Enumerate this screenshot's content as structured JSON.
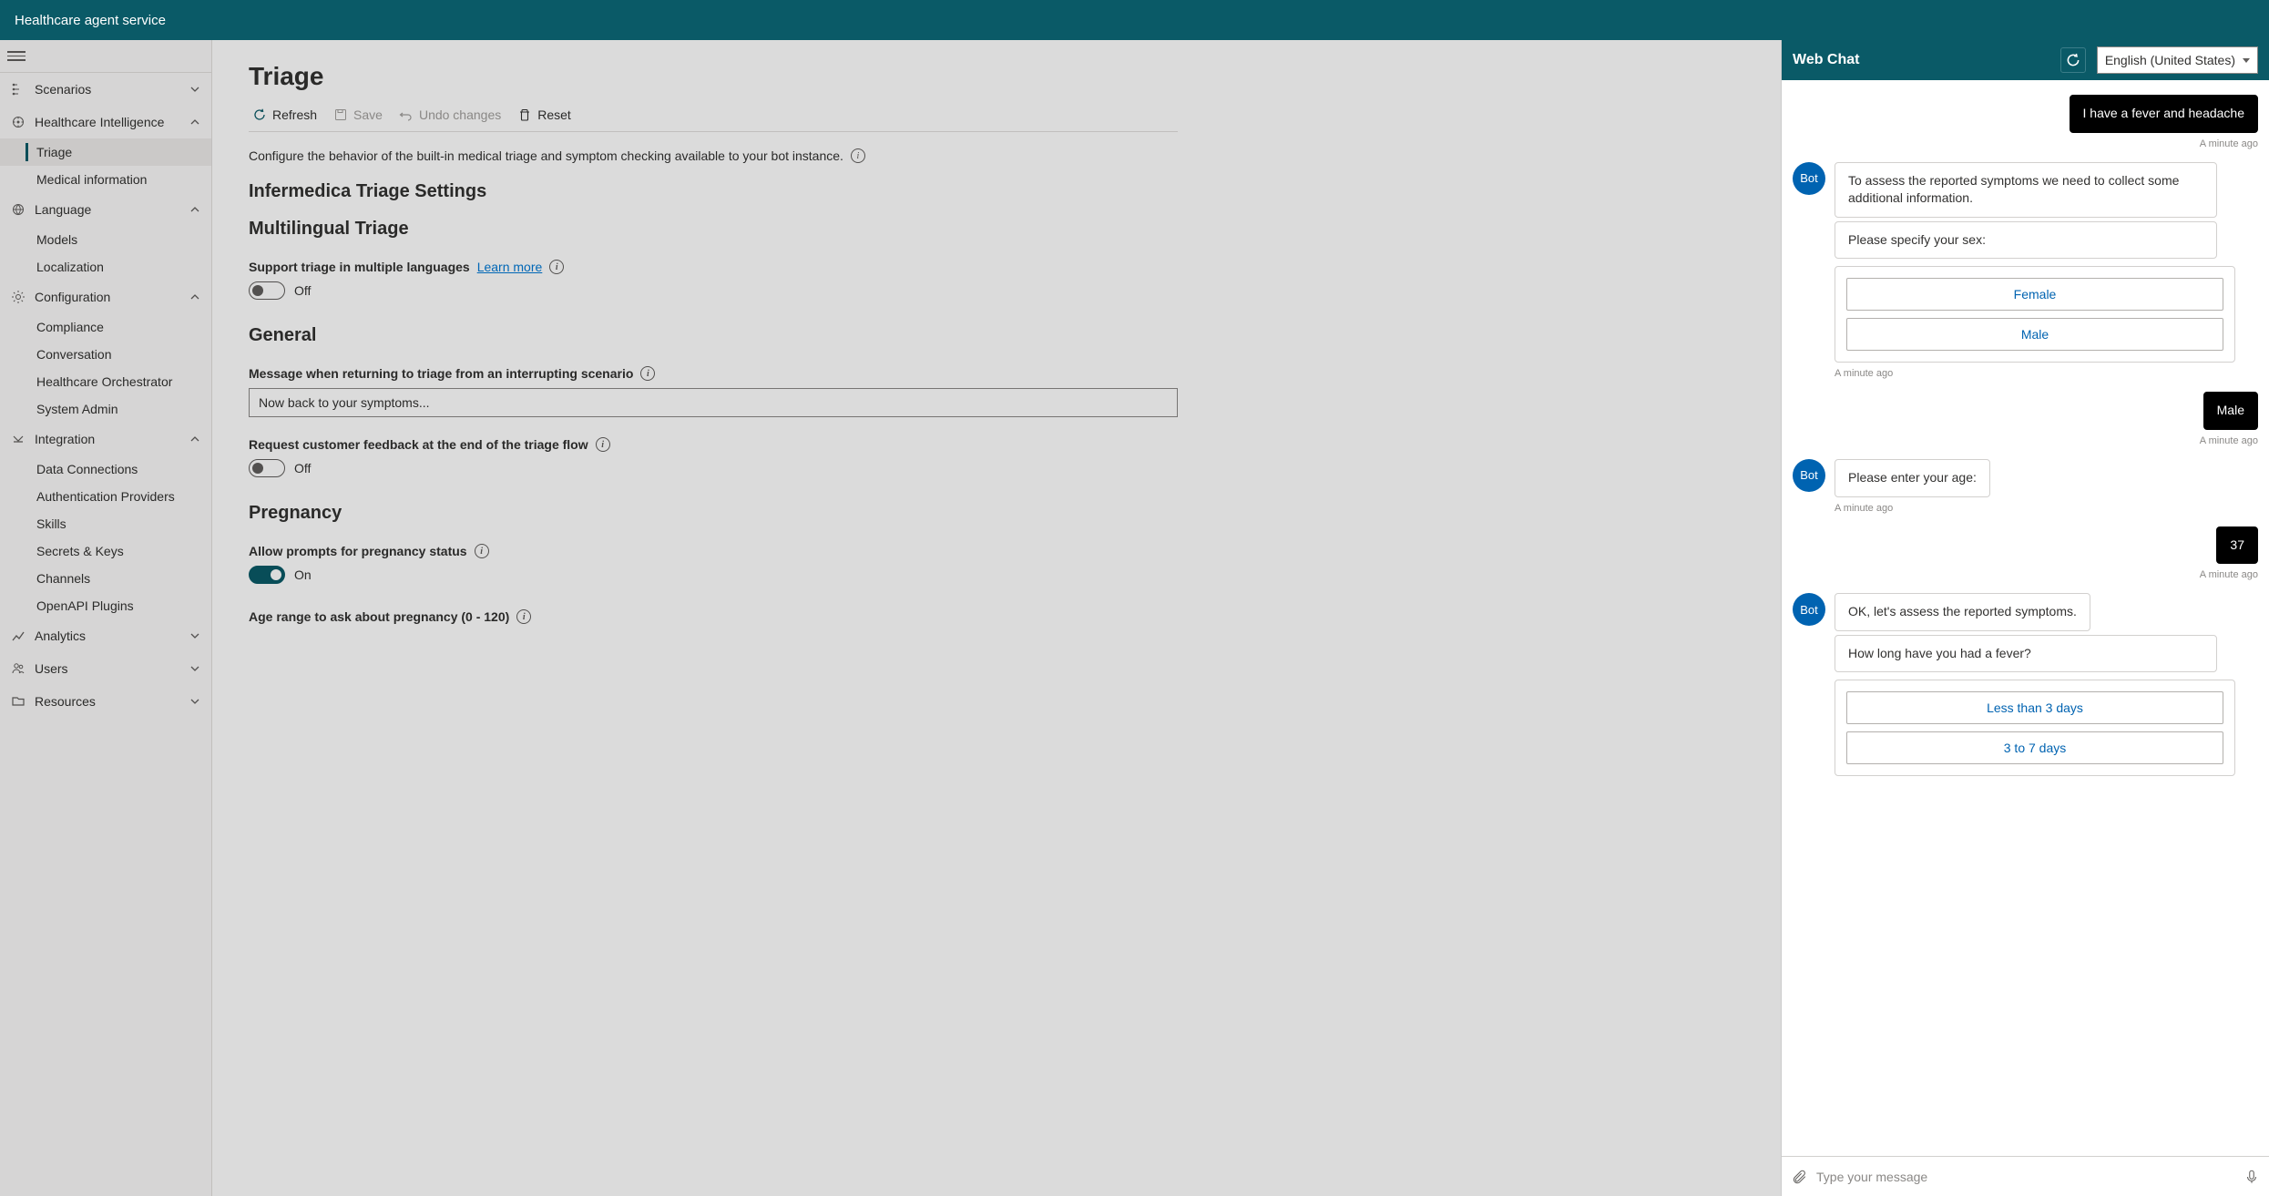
{
  "header": {
    "title": "Healthcare agent service"
  },
  "sidebar": {
    "groups": [
      {
        "label": "Scenarios",
        "expanded": false,
        "items": []
      },
      {
        "label": "Healthcare Intelligence",
        "expanded": true,
        "items": [
          {
            "label": "Triage",
            "active": true
          },
          {
            "label": "Medical information"
          }
        ]
      },
      {
        "label": "Language",
        "expanded": true,
        "items": [
          {
            "label": "Models"
          },
          {
            "label": "Localization"
          }
        ]
      },
      {
        "label": "Configuration",
        "expanded": true,
        "items": [
          {
            "label": "Compliance"
          },
          {
            "label": "Conversation"
          },
          {
            "label": "Healthcare Orchestrator"
          },
          {
            "label": "System Admin"
          }
        ]
      },
      {
        "label": "Integration",
        "expanded": true,
        "items": [
          {
            "label": "Data Connections"
          },
          {
            "label": "Authentication Providers"
          },
          {
            "label": "Skills"
          },
          {
            "label": "Secrets & Keys"
          },
          {
            "label": "Channels"
          },
          {
            "label": "OpenAPI Plugins"
          }
        ]
      },
      {
        "label": "Analytics",
        "expanded": false,
        "items": []
      },
      {
        "label": "Users",
        "expanded": false,
        "items": []
      },
      {
        "label": "Resources",
        "expanded": false,
        "items": []
      }
    ]
  },
  "main": {
    "title": "Triage",
    "toolbar": {
      "refresh": "Refresh",
      "save": "Save",
      "undo": "Undo changes",
      "reset": "Reset"
    },
    "description": "Configure the behavior of the built-in medical triage and symptom checking available to your bot instance.",
    "sections": {
      "infermedica": "Infermedica Triage Settings",
      "multilingual": {
        "heading": "Multilingual Triage",
        "label": "Support triage in multiple languages",
        "learn_more": "Learn more",
        "toggle_value": "Off"
      },
      "general": {
        "heading": "General",
        "return_msg_label": "Message when returning to triage from an interrupting scenario",
        "return_msg_value": "Now back to your symptoms...",
        "feedback_label": "Request customer feedback at the end of the triage flow",
        "feedback_value": "Off"
      },
      "pregnancy": {
        "heading": "Pregnancy",
        "allow_label": "Allow prompts for pregnancy status",
        "allow_value": "On",
        "age_label": "Age range to ask about pregnancy (0 - 120)"
      }
    }
  },
  "chat": {
    "title": "Web Chat",
    "language": "English (United States)",
    "bot_avatar": "Bot",
    "input_placeholder": "Type your message",
    "messages": {
      "m1_user": "I have a fever and headache",
      "m1_ts": "A minute ago",
      "m2_bot_a": "To assess the reported symptoms we need to collect some additional information.",
      "m2_bot_b": "Please specify your sex:",
      "m2_opt_female": "Female",
      "m2_opt_male": "Male",
      "m2_ts": "A minute ago",
      "m3_user": "Male",
      "m3_ts": "A minute ago",
      "m4_bot": "Please enter your age:",
      "m4_ts": "A minute ago",
      "m5_user": "37",
      "m5_ts": "A minute ago",
      "m6_bot_a": "OK, let's assess the reported symptoms.",
      "m6_bot_b": "How long have you had a fever?",
      "m6_opt_a": "Less than 3 days",
      "m6_opt_b": "3 to 7 days"
    }
  }
}
